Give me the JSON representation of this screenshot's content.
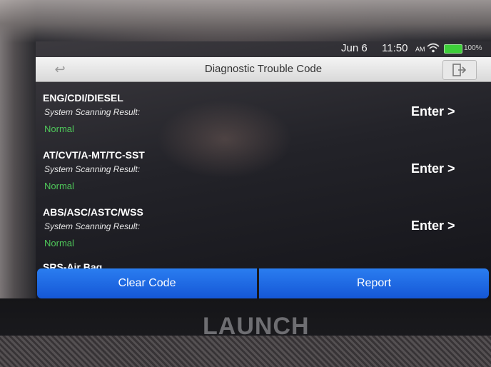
{
  "status_bar": {
    "date": "Jun 6",
    "time": "11:50",
    "ampm": "AM",
    "battery": "100%",
    "battery_color": "#3ecf3a"
  },
  "header": {
    "title": "Diagnostic Trouble Code",
    "back_icon": "back-arrow-icon",
    "exit_icon": "exit-icon"
  },
  "systems": [
    {
      "name": "ENG/CDI/DIESEL",
      "scan_label": "System Scanning Result:",
      "result": "Normal",
      "enter_label": "Enter >"
    },
    {
      "name": "AT/CVT/A-MT/TC-SST",
      "scan_label": "System Scanning Result:",
      "result": "Normal",
      "enter_label": "Enter >"
    },
    {
      "name": "ABS/ASC/ASTC/WSS",
      "scan_label": "System Scanning Result:",
      "result": "Normal",
      "enter_label": "Enter >"
    }
  ],
  "partial_item": "SRS-Air Bag",
  "actions": {
    "clear_code": "Clear Code",
    "report": "Report"
  },
  "device": {
    "brand": "LAUNCH"
  },
  "colors": {
    "accent_blue": "#1f6ae6",
    "normal_green": "#4fc85a"
  }
}
